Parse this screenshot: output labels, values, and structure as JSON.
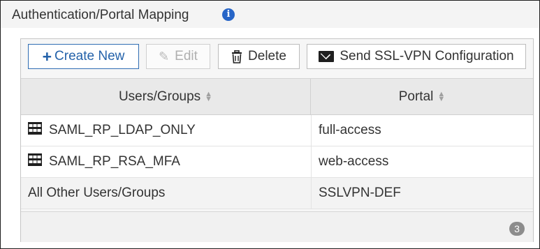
{
  "section": {
    "title": "Authentication/Portal Mapping",
    "info_icon": "info-circle-icon",
    "info_glyph": "i",
    "accent_color": "#2765c7"
  },
  "toolbar": {
    "create_new_label": "Create New",
    "create_new_icon": "plus-icon",
    "edit_label": "Edit",
    "edit_icon": "pencil-icon",
    "delete_label": "Delete",
    "delete_icon": "trash-icon",
    "send_label": "Send SSL-VPN Configuration",
    "send_icon": "envelope-icon"
  },
  "table": {
    "columns": [
      {
        "label": "Users/Groups",
        "sort_icon": "sort-icon"
      },
      {
        "label": "Portal",
        "sort_icon": "sort-icon"
      }
    ],
    "rows": [
      {
        "user_group": "SAML_RP_LDAP_ONLY",
        "icon": "user-group-icon",
        "portal": "full-access"
      },
      {
        "user_group": "SAML_RP_RSA_MFA",
        "icon": "user-group-icon",
        "portal": "web-access"
      },
      {
        "user_group": "All Other Users/Groups",
        "icon": "",
        "portal": "SSLVPN-DEF"
      }
    ]
  },
  "footer": {
    "row_count": "3"
  }
}
